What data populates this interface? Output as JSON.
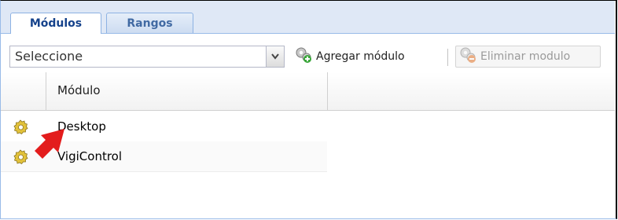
{
  "tabs": [
    {
      "label": "Módulos",
      "active": true
    },
    {
      "label": "Rangos",
      "active": false
    }
  ],
  "toolbar": {
    "combo_value": "Seleccione",
    "add_label": "Agregar módulo",
    "delete_label": "Eliminar modulo",
    "delete_disabled": true
  },
  "grid": {
    "columns": [
      "",
      "Módulo"
    ],
    "rows": [
      {
        "icon": "gear-icon",
        "label": "Desktop"
      },
      {
        "icon": "gear-icon",
        "label": "VigiControl"
      }
    ]
  },
  "annotation": {
    "icon": "red-arrow-icon",
    "color": "#e31c1c"
  }
}
